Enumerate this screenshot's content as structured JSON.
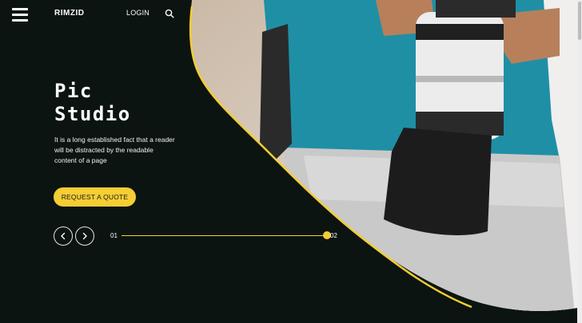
{
  "header": {
    "brand": "RIMZID",
    "login_label": "LOGIN"
  },
  "icons": {
    "menu": "hamburger-menu-icon",
    "search": "search-icon",
    "prev": "chevron-left-icon",
    "next": "chevron-right-icon"
  },
  "hero": {
    "title_line1": "Pic",
    "title_line2": "Studio",
    "description": "It is a long established fact that a reader will be distracted by the readable content of a page",
    "cta_label": "REQUEST A QUOTE"
  },
  "slider": {
    "start_label": "01",
    "end_label": "02",
    "progress": 1.0
  },
  "colors": {
    "background": "#0b1410",
    "accent": "#f5cd34",
    "text": "#ffffff"
  }
}
